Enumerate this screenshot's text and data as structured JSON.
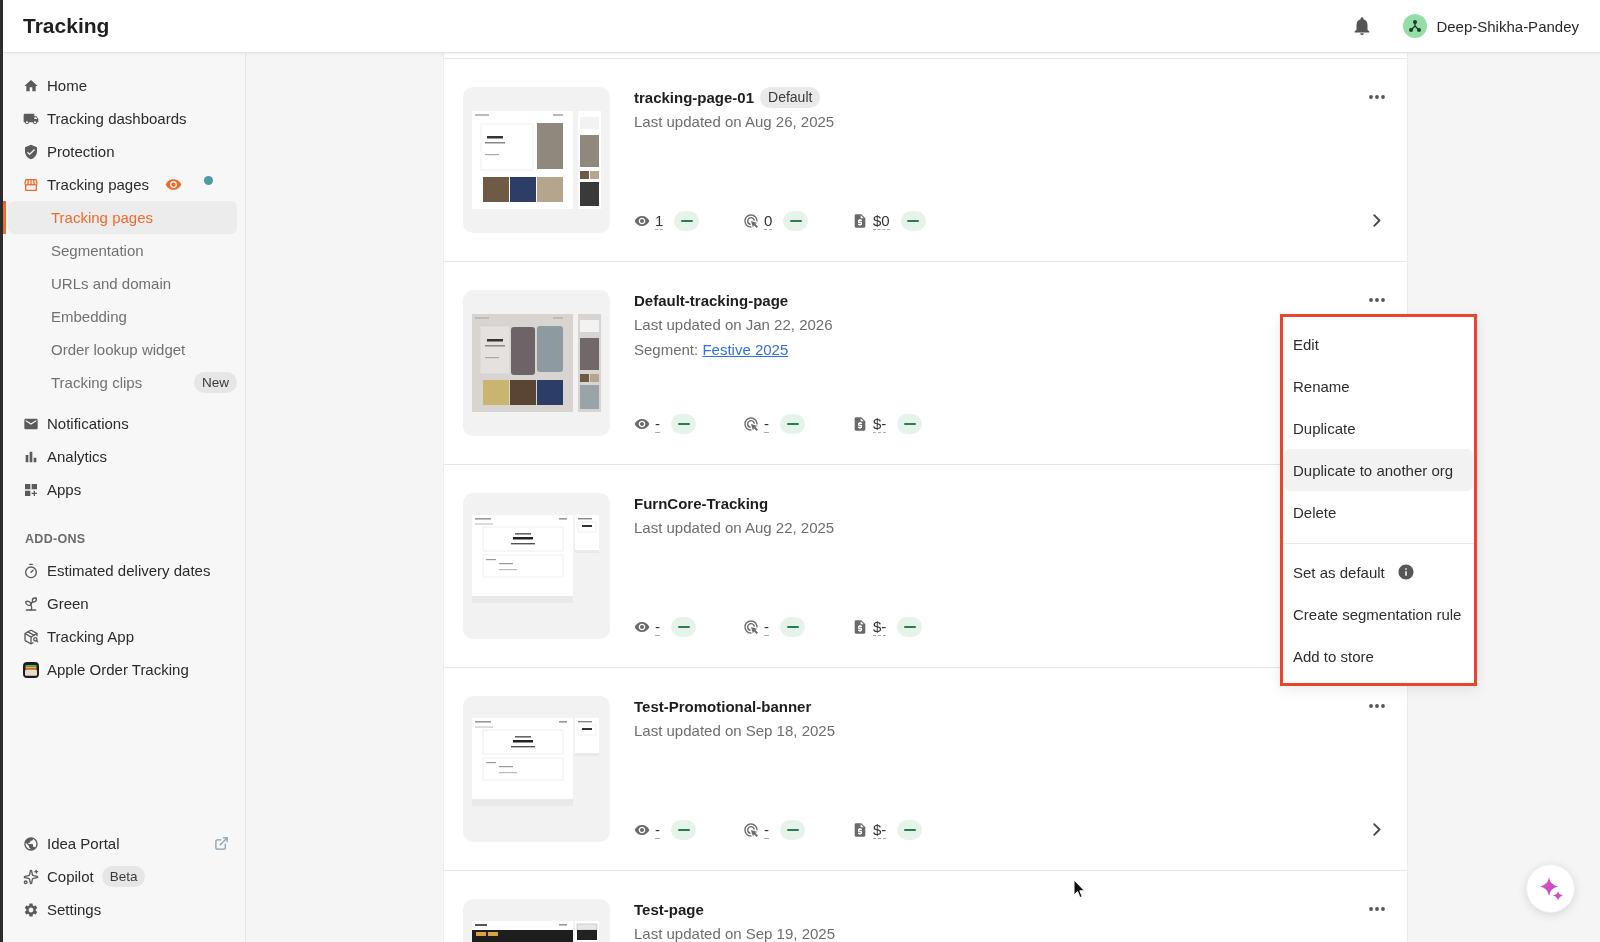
{
  "header": {
    "title": "Tracking",
    "user": "Deep-Shikha-Pandey"
  },
  "sidebar": {
    "items": [
      {
        "label": "Home",
        "selected": false
      },
      {
        "label": "Tracking dashboards",
        "selected": false
      },
      {
        "label": "Protection",
        "selected": false
      },
      {
        "label": "Tracking pages",
        "selected": true,
        "preview_icon": true,
        "dot": true,
        "children": [
          {
            "label": "Tracking pages",
            "selected": true
          },
          {
            "label": "Segmentation",
            "selected": false
          },
          {
            "label": "URLs and domain",
            "selected": false
          },
          {
            "label": "Embedding",
            "selected": false
          },
          {
            "label": "Order lookup widget",
            "selected": false
          },
          {
            "label": "Tracking clips",
            "selected": false,
            "badge": "New"
          }
        ]
      },
      {
        "label": "Notifications",
        "selected": false
      },
      {
        "label": "Analytics",
        "selected": false
      },
      {
        "label": "Apps",
        "selected": false
      }
    ],
    "addons": {
      "heading": "ADD-ONS",
      "items": [
        {
          "label": "Estimated delivery dates",
          "selected": false
        },
        {
          "label": "Green",
          "selected": false
        },
        {
          "label": "Tracking App",
          "selected": false
        },
        {
          "label": "Apple Order Tracking",
          "selected": false
        }
      ]
    },
    "footer_items": [
      {
        "label": "Idea Portal",
        "selected": false,
        "external": true
      },
      {
        "label": "Copilot",
        "selected": false,
        "badge": "Beta"
      },
      {
        "label": "Settings",
        "selected": false
      }
    ]
  },
  "cards": [
    {
      "name": "tracking-page-01",
      "badge": "Default",
      "updated": "Last updated on Aug 26, 2025",
      "thumbnail": {
        "kind": "photos"
      },
      "stats": [
        "1",
        "0",
        "$0"
      ],
      "actions": [
        {
          "kind": "more"
        },
        {
          "kind": "open"
        }
      ]
    },
    {
      "name": "Default-tracking-page",
      "updated": "Last updated on Jan 22, 2026",
      "segment": {
        "label": "Segment:",
        "link": "Festive 2025"
      },
      "thumbnail": {
        "kind": "photos-tinted"
      },
      "stats": [
        "-",
        "-",
        "$-"
      ],
      "actions": [
        {
          "kind": "more"
        }
      ]
    },
    {
      "name": "FurnCore-Tracking",
      "updated": "Last updated on Aug 22, 2025",
      "thumbnail": {
        "kind": "plain"
      },
      "stats": [
        "-",
        "-",
        "$-"
      ]
    },
    {
      "name": "Test-Promotional-banner",
      "updated": "Last updated on Sep 18, 2025",
      "thumbnail": {
        "kind": "plain"
      },
      "stats": [
        "-",
        "-",
        "$-"
      ],
      "actions": [
        {
          "kind": "more"
        },
        {
          "kind": "open"
        }
      ]
    },
    {
      "name": "Test-page",
      "updated": "Last updated on Sep 19, 2025",
      "thumbnail": {
        "kind": "banner"
      },
      "actions": [
        {
          "kind": "more"
        }
      ]
    }
  ],
  "menu": {
    "groups": [
      [
        {
          "label": "Edit",
          "highlighted": false,
          "info": false
        },
        {
          "label": "Rename",
          "highlighted": false,
          "info": false
        },
        {
          "label": "Duplicate",
          "highlighted": false,
          "info": false
        },
        {
          "label": "Duplicate to another org",
          "highlighted": true,
          "info": false
        },
        {
          "label": "Delete",
          "highlighted": false,
          "info": false
        }
      ],
      [
        {
          "label": "Set as default",
          "highlighted": false,
          "info": true
        },
        {
          "label": "Create segmentation rule",
          "highlighted": false,
          "info": false
        },
        {
          "label": "Add to store",
          "highlighted": false,
          "info": false
        }
      ]
    ]
  }
}
